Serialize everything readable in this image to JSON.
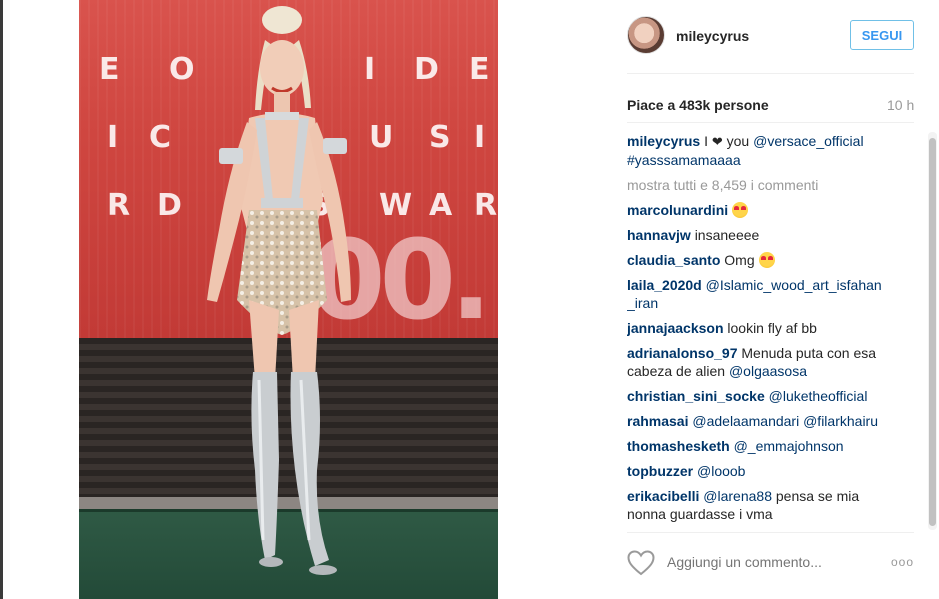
{
  "post": {
    "username": "mileycyrus",
    "follow_label": "SEGUI",
    "likes_text": "Piace a 483k persone",
    "time_ago": "10 h",
    "caption": {
      "user": "mileycyrus",
      "text_before": "I",
      "text_after": "you",
      "mention": "@versace_official",
      "hashtag": "#yasssamamaaaa"
    },
    "view_all_comments": "mostra tutti e 8,459 i commenti",
    "comments": [
      {
        "user": "marcolunardini",
        "text": "",
        "emoji": "heart-eyes"
      },
      {
        "user": "hannavjw",
        "text": "insaneeee"
      },
      {
        "user": "claudia_santo",
        "text": "Omg",
        "emoji": "heart-eyes"
      },
      {
        "user": "laila_2020d",
        "mention": "@Islamic_wood_art_isfahan",
        "line2": "_iran"
      },
      {
        "user": "jannajaackson",
        "text": "lookin fly af bb"
      },
      {
        "user": "adrianalonso_97",
        "text": "Menuda puta con esa",
        "line2": "cabeza de alien",
        "mention2": "@olgaasosa"
      },
      {
        "user": "christian_sini_socke",
        "mention": "@luketheofficial"
      },
      {
        "user": "rahmasai",
        "mention": "@adelaamandari @filarkhairu"
      },
      {
        "user": "thomashesketh",
        "mention": "@_emmajohnson"
      },
      {
        "user": "topbuzzer",
        "mention": "@looob"
      },
      {
        "user": "erikacibelli",
        "mention": "@larena88",
        "text": "pensa se mia",
        "line2": "nonna guardasse i vma"
      }
    ],
    "add_comment_placeholder": "Aggiungi un commento...",
    "more_options": "ooo"
  },
  "photo": {
    "backdrop_rows": [
      [
        "E",
        "O",
        "V",
        "I",
        "D",
        "E"
      ],
      [
        "I",
        "C",
        "U",
        "S",
        "I"
      ],
      [
        "R",
        "D",
        "S",
        "W",
        "A",
        "R"
      ]
    ],
    "big_text": "00."
  },
  "colors": {
    "link": "#003569",
    "button_text": "#3897f0",
    "button_border": "#70c0e7",
    "muted": "#999999",
    "backdrop_red": "#cf4640"
  },
  "icons": {
    "like": "heart-outline-icon",
    "caption_heart": "heart-icon",
    "more": "more-options-icon"
  }
}
